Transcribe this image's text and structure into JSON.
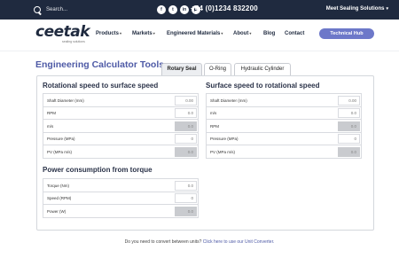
{
  "topbar": {
    "search_placeholder": "Search...",
    "socials": [
      "f",
      "t",
      "in",
      "▶"
    ],
    "phone": "+44 (0)1234 832200",
    "right_link": "Meet Sealing Solutions"
  },
  "header": {
    "logo_text": "ceetak",
    "logo_subtext": "sealing solutions",
    "nav": [
      {
        "label": "Products",
        "dropdown": true
      },
      {
        "label": "Markets",
        "dropdown": true
      },
      {
        "label": "Engineered Materials",
        "dropdown": true
      },
      {
        "label": "About",
        "dropdown": true
      },
      {
        "label": "Blog",
        "dropdown": false
      },
      {
        "label": "Contact",
        "dropdown": false
      }
    ],
    "hub_button": "Technical Hub"
  },
  "page": {
    "title": "Engineering Calculator Tools",
    "tabs": [
      {
        "label": "Rotary Seal",
        "active": true
      },
      {
        "label": "O-Ring",
        "active": false
      },
      {
        "label": "Hydraulic Cylinder",
        "active": false
      }
    ]
  },
  "calculators": {
    "rot_to_surface": {
      "title": "Rotational speed to surface speed",
      "rows": [
        {
          "label": "Shaft Diameter (mm)",
          "value": "0.00",
          "output": false
        },
        {
          "label": "RPM",
          "value": "0.0",
          "output": false
        },
        {
          "label": "m/s",
          "value": "0.0",
          "output": true
        },
        {
          "label": "Pressure (MPa)",
          "value": "0",
          "output": false
        },
        {
          "label": "PV (MPa m/s)",
          "value": "0.0",
          "output": true
        }
      ]
    },
    "surface_to_rot": {
      "title": "Surface speed to rotational speed",
      "rows": [
        {
          "label": "Shaft Diameter (mm)",
          "value": "0.00",
          "output": false
        },
        {
          "label": "m/s",
          "value": "0.0",
          "output": false
        },
        {
          "label": "RPM",
          "value": "0.0",
          "output": true
        },
        {
          "label": "Pressure (MPa)",
          "value": "0",
          "output": false
        },
        {
          "label": "PV (MPa m/s)",
          "value": "0.0",
          "output": true
        }
      ]
    },
    "power": {
      "title": "Power consumption from torque",
      "rows": [
        {
          "label": "Torque (Nm)",
          "value": "0.0",
          "output": false
        },
        {
          "label": "Speed (RPM)",
          "value": "0",
          "output": false
        },
        {
          "label": "Power (W)",
          "value": "0.0",
          "output": true
        }
      ]
    }
  },
  "footer": {
    "text": "Do you need to convert between units?",
    "link": "Click here to use our Unit Converter."
  },
  "colors": {
    "topbar": "#1f2a3f",
    "accent": "#4e5aa6",
    "hub_button": "#6d78c9",
    "output_field": "#c9cbcf"
  }
}
